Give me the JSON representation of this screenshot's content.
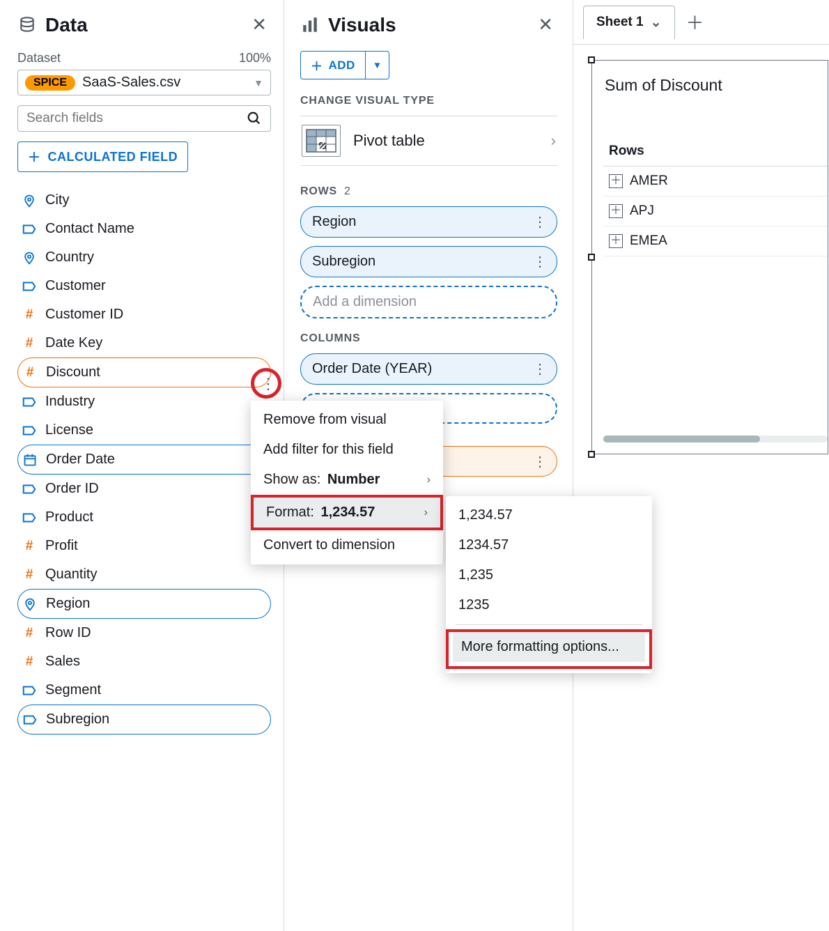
{
  "data_panel": {
    "title": "Data",
    "dataset_label": "Dataset",
    "percent": "100%",
    "spice_badge": "SPICE",
    "dataset_name": "SaaS-Sales.csv",
    "search_placeholder": "Search fields",
    "calc_btn": "CALCULATED FIELD",
    "fields": [
      {
        "name": "City",
        "type": "geo"
      },
      {
        "name": "Contact Name",
        "type": "str"
      },
      {
        "name": "Country",
        "type": "geo"
      },
      {
        "name": "Customer",
        "type": "str"
      },
      {
        "name": "Customer ID",
        "type": "num"
      },
      {
        "name": "Date Key",
        "type": "num"
      },
      {
        "name": "Discount",
        "type": "num",
        "active": "orange"
      },
      {
        "name": "Industry",
        "type": "str"
      },
      {
        "name": "License",
        "type": "str"
      },
      {
        "name": "Order Date",
        "type": "date",
        "active": "blue"
      },
      {
        "name": "Order ID",
        "type": "str"
      },
      {
        "name": "Product",
        "type": "str"
      },
      {
        "name": "Profit",
        "type": "num"
      },
      {
        "name": "Quantity",
        "type": "num"
      },
      {
        "name": "Region",
        "type": "geo",
        "active": "blue"
      },
      {
        "name": "Row ID",
        "type": "num"
      },
      {
        "name": "Sales",
        "type": "num"
      },
      {
        "name": "Segment",
        "type": "str"
      },
      {
        "name": "Subregion",
        "type": "str",
        "active": "blue"
      }
    ]
  },
  "visuals_panel": {
    "title": "Visuals",
    "add_btn": "ADD",
    "change_label": "CHANGE VISUAL TYPE",
    "visual_type": "Pivot table",
    "rows_label": "ROWS",
    "rows_count": "2",
    "rows": [
      "Region",
      "Subregion"
    ],
    "rows_placeholder": "Add a dimension",
    "columns_label": "COLUMNS",
    "columns": [
      "Order Date (YEAR)"
    ]
  },
  "context_menu": {
    "remove": "Remove from visual",
    "add_filter": "Add filter for this field",
    "show_as_prefix": "Show as:",
    "show_as_value": "Number",
    "format_prefix": "Format:",
    "format_value": "1,234.57",
    "convert": "Convert to dimension"
  },
  "format_submenu": {
    "opt1": "1,234.57",
    "opt2": "1234.57",
    "opt3": "1,235",
    "opt4": "1235",
    "more": "More formatting options..."
  },
  "sheet": {
    "tab": "Sheet 1",
    "vis_title": "Sum of Discount",
    "rows_header": "Rows",
    "rows": [
      "AMER",
      "APJ",
      "EMEA"
    ]
  }
}
